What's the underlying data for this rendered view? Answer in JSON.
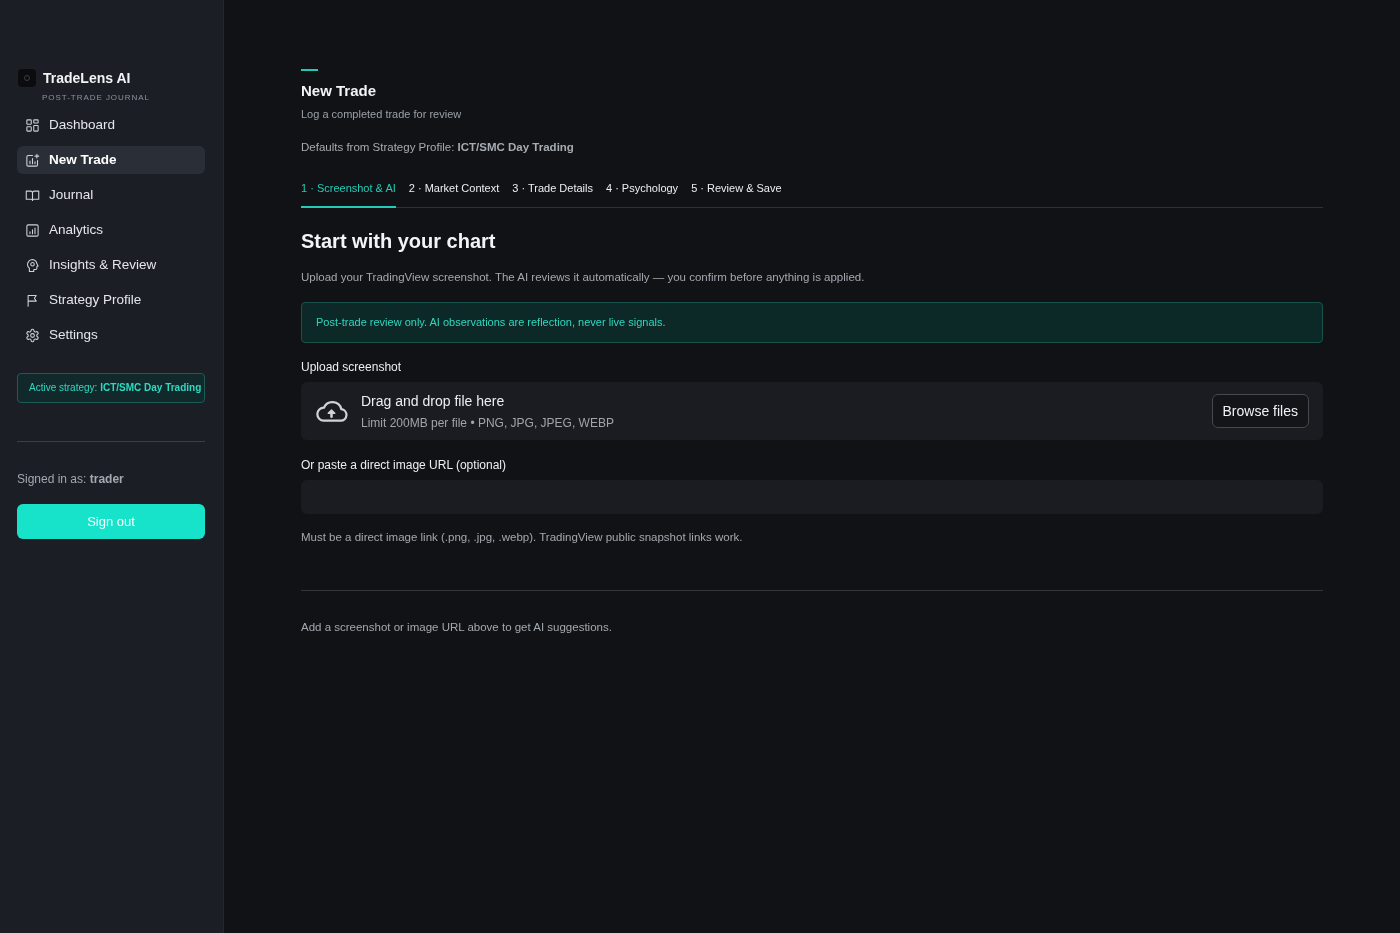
{
  "sidebar": {
    "logo": {
      "title": "TradeLens AI",
      "subtitle": "POST-TRADE JOURNAL"
    },
    "nav": [
      {
        "label": "Dashboard",
        "selected": false
      },
      {
        "label": "New Trade",
        "selected": true
      },
      {
        "label": "Journal",
        "selected": false
      },
      {
        "label": "Analytics",
        "selected": false
      },
      {
        "label": "Insights & Review",
        "selected": false
      },
      {
        "label": "Strategy Profile",
        "selected": false
      },
      {
        "label": "Settings",
        "selected": false
      }
    ],
    "active_strategy": "Active strategy: **ICT/SMC Day Trading**",
    "signed_in": "Signed in as: **trader**",
    "sign_out": "Sign out"
  },
  "page": {
    "title": "New Trade",
    "subtitle": "Log a completed trade for review",
    "defaults": "Defaults from Strategy Profile: **ICT/SMC Day Trading**"
  },
  "steps": [
    {
      "label": "1 · Screenshot & AI",
      "selected": true
    },
    {
      "label": "2 · Market Context",
      "selected": false
    },
    {
      "label": "3 · Trade Details",
      "selected": false
    },
    {
      "label": "4 · Psychology",
      "selected": false
    },
    {
      "label": "5 · Review & Save",
      "selected": false
    }
  ],
  "section": {
    "title": "Start with your chart",
    "description": "Upload your TradingView screenshot. The AI reviews it automatically — you confirm before anything is applied.",
    "notice": "Post-trade review only. AI observations are reflection, never live signals."
  },
  "upload": {
    "label": "Upload screenshot",
    "prompt": "Drag and drop file here",
    "limits": "Limit 200MB per file • PNG, JPG, JPEG, WEBP",
    "button": "Browse files"
  },
  "url_field": {
    "label": "Or paste a direct image URL (optional)",
    "help": "Must be a direct image link (.png, .jpg, .webp). TradingView public snapshot links work."
  },
  "status_message": "Add a screenshot or image URL above to get AI suggestions."
}
